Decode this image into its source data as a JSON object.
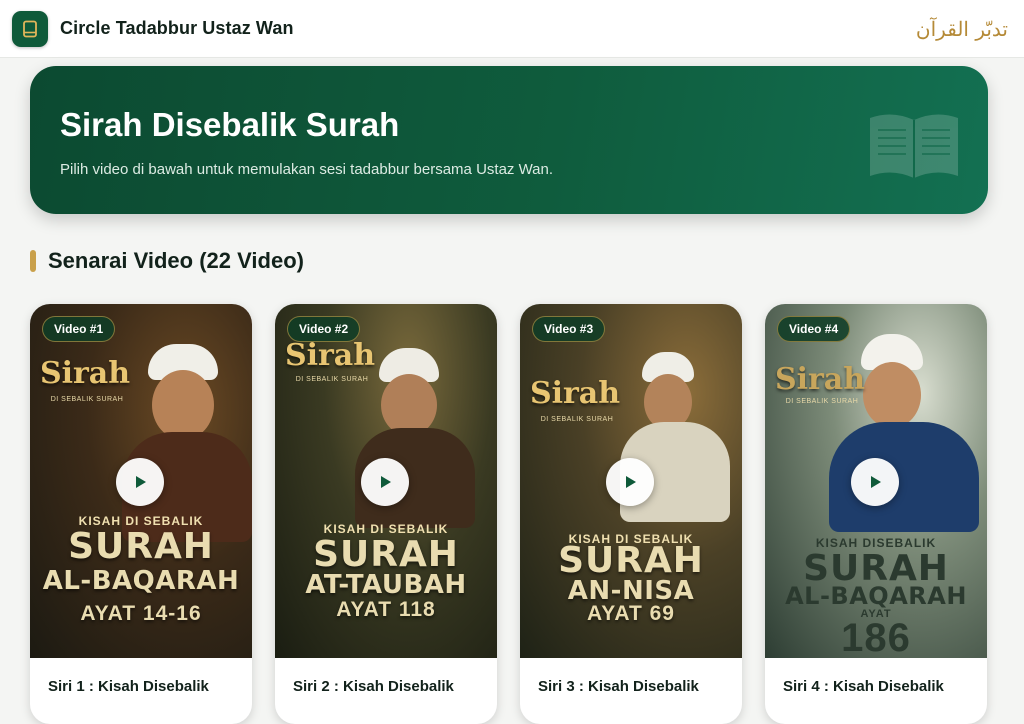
{
  "header": {
    "app_title": "Circle Tadabbur Ustaz Wan",
    "arabic_brand": "تدبّر القرآن",
    "icon": "book-icon"
  },
  "hero": {
    "title": "Sirah Disebalik Surah",
    "subtitle": "Pilih video di bawah untuk memulakan sesi tadabbur bersama Ustaz Wan.",
    "icon": "quran-book-icon"
  },
  "section": {
    "title": "Senarai Video (22 Video)"
  },
  "colors": {
    "primary": "#0f5a3a",
    "accent": "#c9a04a",
    "background": "#f4f5f3"
  },
  "videos": [
    {
      "badge": "Video #1",
      "title": "Siri 1 : Kisah Disebalik",
      "poster": {
        "brand": "Sirah",
        "brand_sub": "DI SEBALIK SURAH",
        "kicker": "KISAH DI SEBALIK",
        "word": "SURAH",
        "name": "AL-BAQARAH",
        "ayat": "AYAT 14-16"
      }
    },
    {
      "badge": "Video #2",
      "title": "Siri 2 : Kisah Disebalik",
      "poster": {
        "brand": "Sirah",
        "brand_sub": "DI SEBALIK SURAH",
        "kicker": "KISAH DI SEBALIK",
        "word": "SURAH",
        "name": "AT-TAUBAH",
        "ayat": "AYAT 118"
      }
    },
    {
      "badge": "Video #3",
      "title": "Siri 3 : Kisah Disebalik",
      "poster": {
        "brand": "Sirah",
        "brand_sub": "DI SEBALIK SURAH",
        "kicker": "KISAH DI SEBALIK",
        "word": "SURAH",
        "name": "AN-NISA",
        "ayat": "AYAT 69"
      }
    },
    {
      "badge": "Video #4",
      "title": "Siri 4 : Kisah Disebalik",
      "poster": {
        "brand": "Sirah",
        "brand_sub": "DI SEBALIK SURAH",
        "kicker": "KISAH DISEBALIK",
        "word": "SURAH",
        "name": "AL-BAQARAH",
        "ayat": "AYAT",
        "ayat_number": "186"
      }
    }
  ]
}
